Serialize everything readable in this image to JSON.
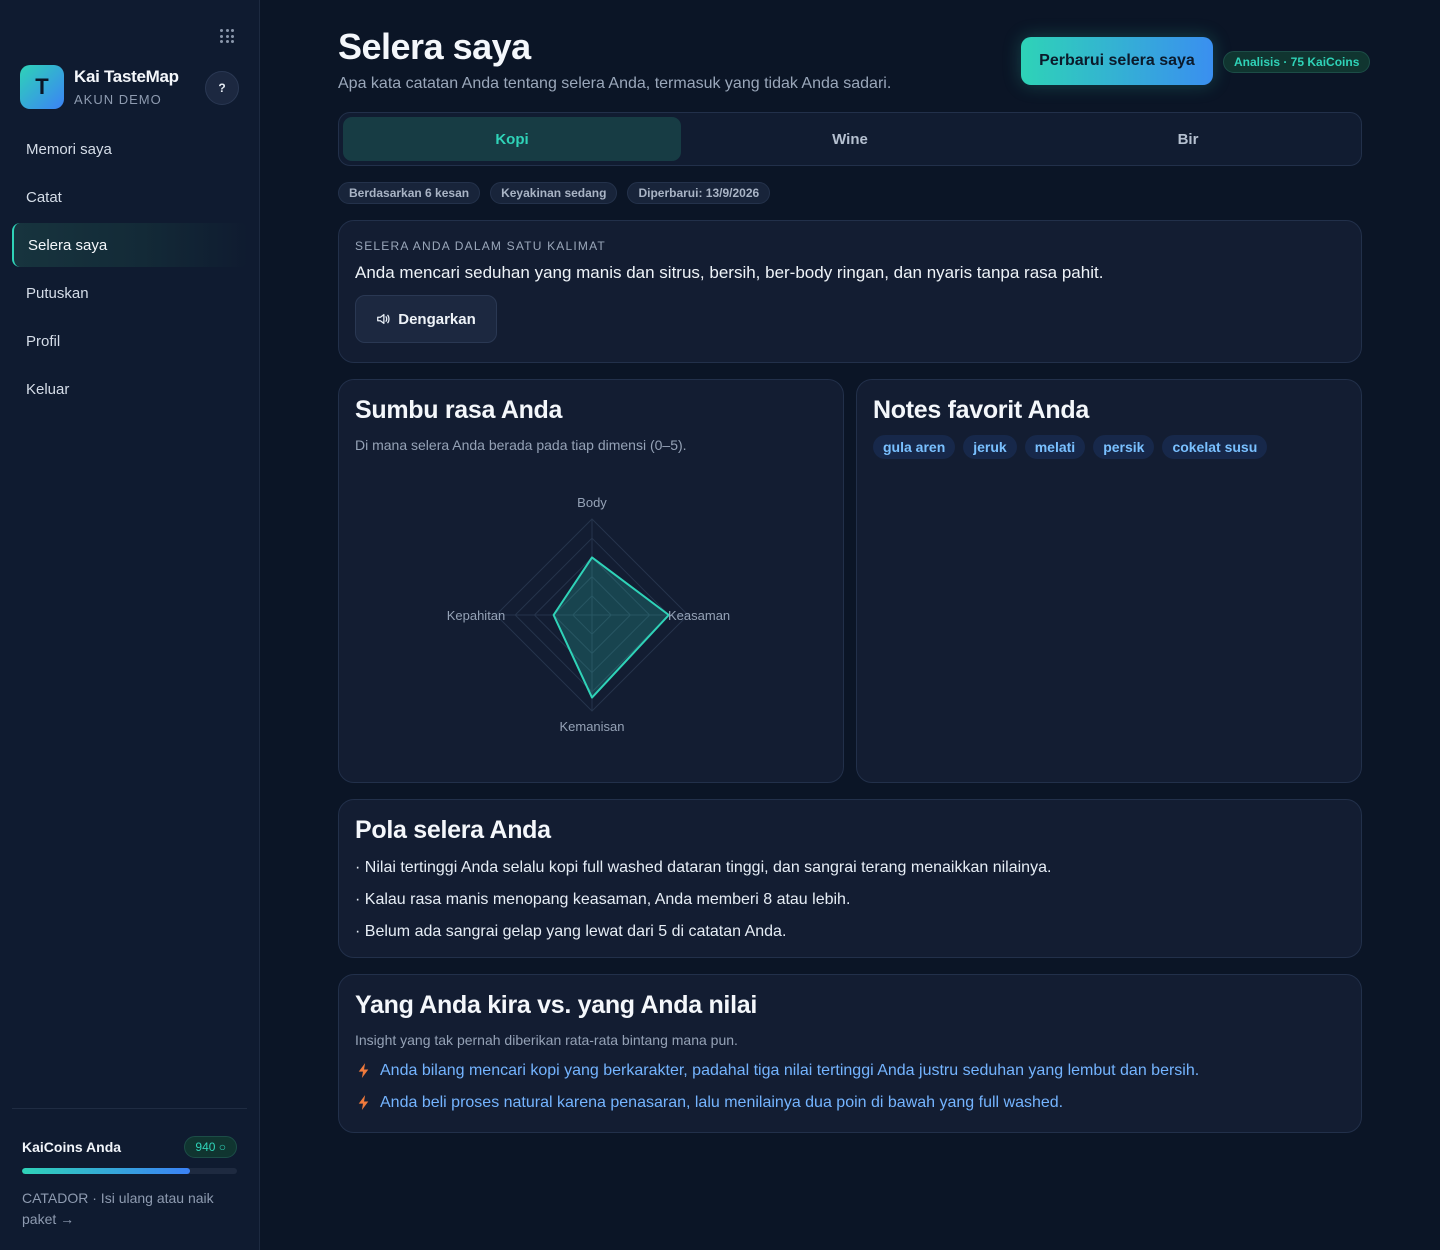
{
  "sidebar": {
    "logo_letter": "T",
    "brand_name": "Kai TasteMap",
    "brand_sub": "AKUN DEMO",
    "help_label": "?",
    "items": [
      {
        "label": "Memori saya"
      },
      {
        "label": "Catat"
      },
      {
        "label": "Selera saya"
      },
      {
        "label": "Putuskan"
      },
      {
        "label": "Profil"
      },
      {
        "label": "Keluar"
      }
    ],
    "coins": {
      "title": "KaiCoins Anda",
      "balance": "940 ○",
      "progress": 0.78,
      "note": "CATADOR · Isi ulang atau naik paket →"
    }
  },
  "header": {
    "title": "Selera saya",
    "subtitle": "Apa kata catatan Anda tentang selera Anda, termasuk yang tidak Anda sadari.",
    "cta_label": "Perbarui selera saya",
    "cost_badge": "Analisis · 75 KaiCoins"
  },
  "tabs": [
    {
      "label": "Kopi",
      "active": true
    },
    {
      "label": "Wine",
      "active": false
    },
    {
      "label": "Bir",
      "active": false
    }
  ],
  "chips": [
    "Berdasarkan 6 kesan",
    "Keyakinan sedang",
    "Diperbarui: 13/9/2026"
  ],
  "summary": {
    "eyebrow": "SELERA ANDA DALAM SATU KALIMAT",
    "text": "Anda mencari seduhan yang manis dan sitrus, bersih, ber-body ringan, dan nyaris tanpa rasa pahit.",
    "listen_label": "Dengarkan"
  },
  "axes": {
    "title": "Sumbu rasa Anda",
    "subtitle": "Di mana selera Anda berada pada tiap dimensi (0–5).",
    "max": 5,
    "labels": {
      "top": "Body",
      "right": "Keasaman",
      "bottom": "Kemanisan",
      "left": "Kepahitan"
    },
    "values": {
      "body": 3.0,
      "keasaman": 4.0,
      "kemanisan": 4.3,
      "kepahitan": 2.0
    },
    "accent": "#2fd3b8"
  },
  "notes": {
    "title": "Notes favorit Anda",
    "tags": [
      "gula aren",
      "jeruk",
      "melati",
      "persik",
      "cokelat susu"
    ]
  },
  "pattern": {
    "title": "Pola selera Anda",
    "bullets": [
      "· Nilai tertinggi Anda selalu kopi full washed dataran tinggi, dan sangrai terang menaikkan nilainya.",
      "· Kalau rasa manis menopang keasaman, Anda memberi 8 atau lebih.",
      "· Belum ada sangrai gelap yang lewat dari 5 di catatan Anda."
    ]
  },
  "versus": {
    "title": "Yang Anda kira vs. yang Anda nilai",
    "subtitle": "Insight yang tak pernah diberikan rata-rata bintang mana pun.",
    "insights": [
      "Anda bilang mencari kopi yang berkarakter, padahal tiga nilai tertinggi Anda justru seduhan yang lembut dan bersih.",
      "Anda beli proses natural karena penasaran, lalu menilainya dua poin di bawah yang full washed."
    ]
  }
}
